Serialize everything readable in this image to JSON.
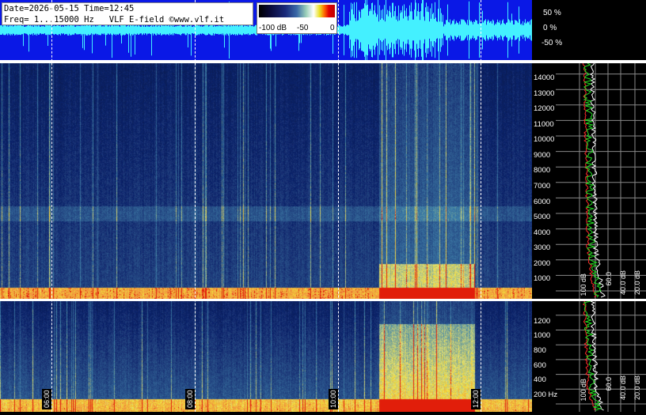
{
  "info": {
    "line1": "Date=2026-05-15 Time=12:45",
    "line2": "Freq= 1...15000 Hz   VLF E-field ©www.vlf.it"
  },
  "colorbar": {
    "labels": [
      "-100 dB",
      "-50",
      "0"
    ]
  },
  "amplitude_axis": {
    "labels": [
      "50 %",
      "0 %",
      "-50 %"
    ]
  },
  "upper_freq_axis": {
    "labels": [
      "14000",
      "13000",
      "12000",
      "11000",
      "10000",
      "9000",
      "8000",
      "7000",
      "6000",
      "5000",
      "4000",
      "3000",
      "2000",
      "1000"
    ]
  },
  "lower_freq_axis": {
    "labels": [
      "1200",
      "1000",
      "800",
      "600",
      "400",
      "200 Hz"
    ]
  },
  "time_axis": {
    "labels": [
      "06:00",
      "08:00",
      "10:00",
      "12:00"
    ]
  },
  "db_axis_upper": {
    "labels": [
      "100 dB",
      "60.0",
      "40.0 dB",
      "20.0 dB"
    ]
  },
  "db_axis_lower": {
    "labels": [
      "100 dB",
      "60.0",
      "40.0 dB",
      "20.0 dB"
    ]
  },
  "colors": {
    "waveform_bg": "#0a18e6",
    "waveform_trace": "#44f0ff",
    "spectrum_curve_green": "#22dd22",
    "spectrum_curve_red": "#ff2a2a",
    "spectrum_curve_white": "#ffffff"
  }
}
